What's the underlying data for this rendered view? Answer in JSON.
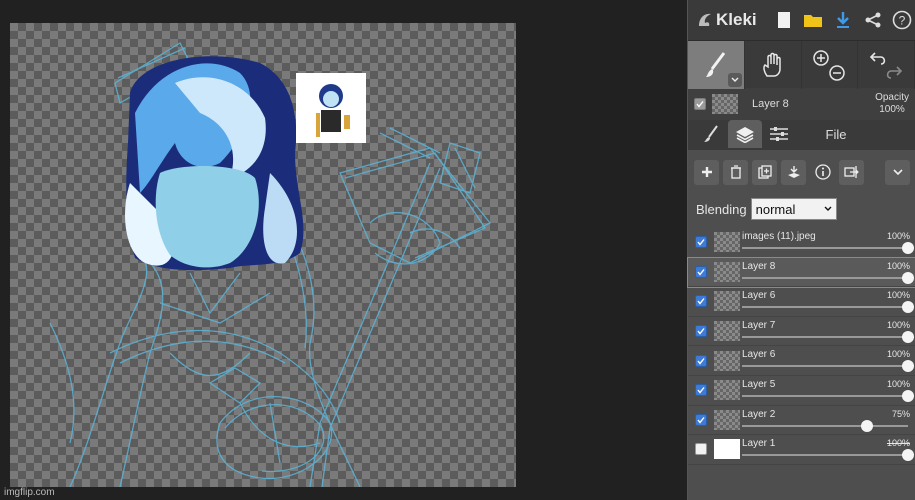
{
  "app": {
    "name": "Kleki"
  },
  "watermark": "imgflip.com",
  "colors": {
    "accent": "#3d7bd6",
    "panel": "#3a3a3a",
    "stroke": "#5bb4d8"
  },
  "current_layer": {
    "name": "Layer 8",
    "opacity_label": "Opacity",
    "opacity_value": "100%"
  },
  "tabs": {
    "file": "File"
  },
  "blending": {
    "label": "Blending",
    "value": "normal"
  },
  "layers": [
    {
      "name": "images (11).jpeg",
      "opacity": "100%",
      "level": 1.0,
      "checked": true
    },
    {
      "name": "Layer 8",
      "opacity": "100%",
      "level": 1.0,
      "checked": true,
      "active": true
    },
    {
      "name": "Layer 6",
      "opacity": "100%",
      "level": 1.0,
      "checked": true
    },
    {
      "name": "Layer 7",
      "opacity": "100%",
      "level": 1.0,
      "checked": true
    },
    {
      "name": "Layer 6",
      "opacity": "100%",
      "level": 1.0,
      "checked": true
    },
    {
      "name": "Layer 5",
      "opacity": "100%",
      "level": 1.0,
      "checked": true
    },
    {
      "name": "Layer 2",
      "opacity": "75%",
      "level": 0.75,
      "checked": true
    },
    {
      "name": "Layer 1",
      "opacity": "100%",
      "level": 1.0,
      "checked": false
    }
  ]
}
